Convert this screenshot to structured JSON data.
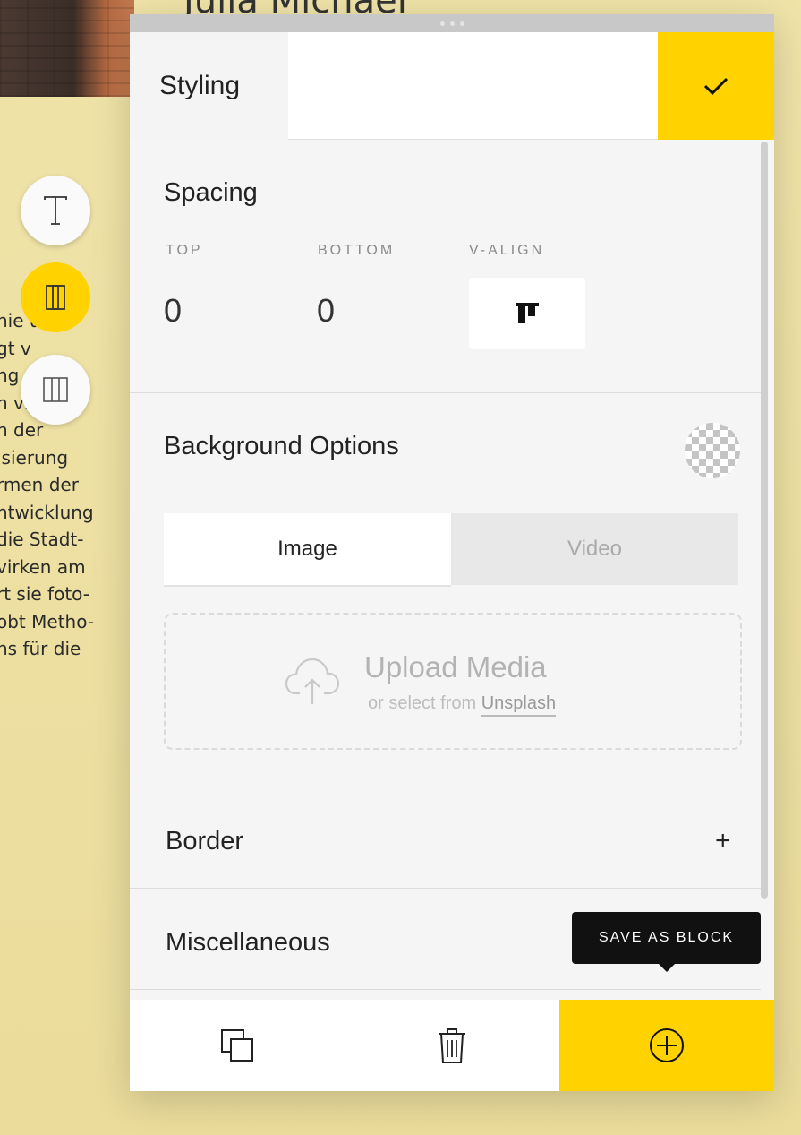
{
  "background_page": {
    "heading": "Julia Michael",
    "text_lines": [
      "hie  u",
      "gt v",
      "ng",
      "n viel mit",
      "n der",
      "isierung",
      "rmen der",
      "ntwicklung",
      "die Stadt-",
      "virken am",
      "rt sie foto-",
      "obt Metho-",
      "ns für die"
    ]
  },
  "toolbar_left": {
    "items": [
      {
        "icon": "text-icon"
      },
      {
        "icon": "single-column-icon"
      },
      {
        "icon": "two-column-icon"
      }
    ]
  },
  "panel": {
    "header": {
      "tab_label": "Styling",
      "confirm_icon": "check-icon"
    },
    "spacing": {
      "title": "Spacing",
      "top_label": "TOP",
      "top_value": "0",
      "bottom_label": "BOTTOM",
      "bottom_value": "0",
      "valign_label": "V-ALIGN",
      "valign_icon": "align-top-icon"
    },
    "background": {
      "title": "Background Options",
      "swatch_icon": "transparent-swatch",
      "tabs": [
        {
          "label": "Image",
          "active": true
        },
        {
          "label": "Video",
          "active": false
        }
      ],
      "upload": {
        "title": "Upload Media",
        "subtitle_prefix": "or select from",
        "link": "Unsplash",
        "icon": "cloud-upload-icon"
      }
    },
    "border": {
      "title": "Border",
      "expand_icon": "plus-icon"
    },
    "misc": {
      "title": "Miscellaneous"
    },
    "tooltip": "SAVE AS BLOCK",
    "footer": {
      "duplicate_icon": "duplicate-icon",
      "delete_icon": "trash-icon",
      "add_icon": "plus-circle-icon"
    },
    "colors": {
      "accent": "#ffd200",
      "panel": "#f5f5f5"
    }
  }
}
